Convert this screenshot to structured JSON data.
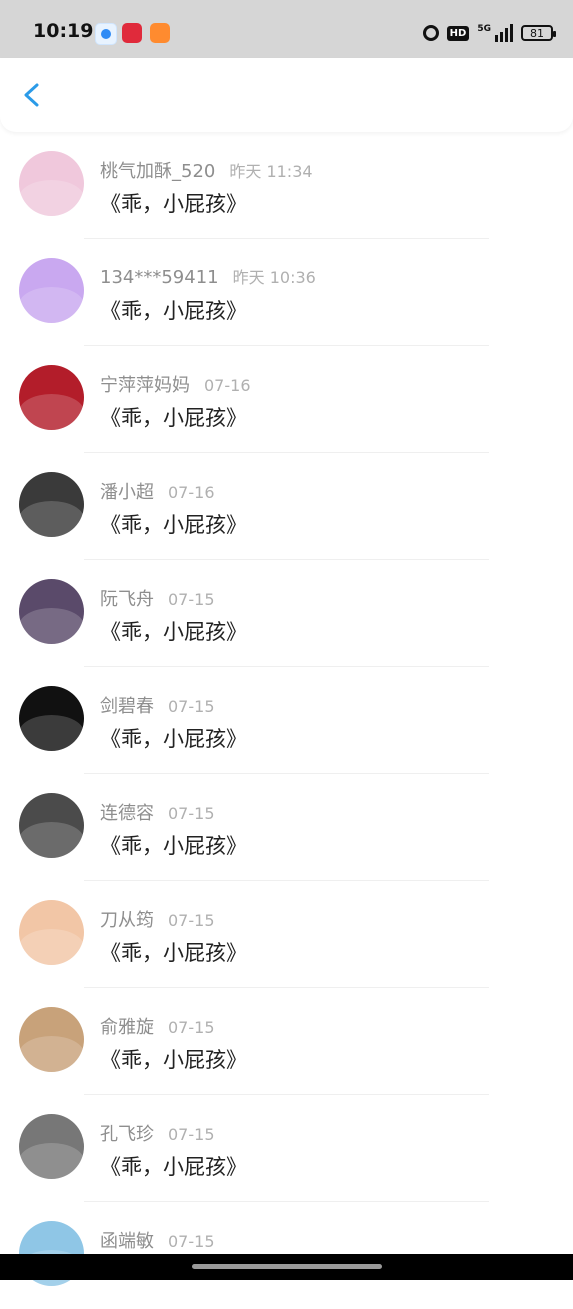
{
  "status_bar": {
    "time": "10:19",
    "network": "5G",
    "hd_label": "HD",
    "battery": "81"
  },
  "items": [
    {
      "name": "桃气加酥_520",
      "time": "昨天 11:34",
      "title": "《乖，小屁孩》",
      "avatar_color": "#f0c8dc"
    },
    {
      "name": "134***59411",
      "time": "昨天 10:36",
      "title": "《乖，小屁孩》",
      "avatar_color": "#c9a8f0"
    },
    {
      "name": "宁萍萍妈妈",
      "time": "07-16",
      "title": "《乖，小屁孩》",
      "avatar_color": "#b31d2a"
    },
    {
      "name": "潘小超",
      "time": "07-16",
      "title": "《乖，小屁孩》",
      "avatar_color": "#3a3a3a"
    },
    {
      "name": "阮飞舟",
      "time": "07-15",
      "title": "《乖，小屁孩》",
      "avatar_color": "#5a4a6a"
    },
    {
      "name": "剑碧春",
      "time": "07-15",
      "title": "《乖，小屁孩》",
      "avatar_color": "#111111"
    },
    {
      "name": "连德容",
      "time": "07-15",
      "title": "《乖，小屁孩》",
      "avatar_color": "#4b4b4b"
    },
    {
      "name": "刀从筠",
      "time": "07-15",
      "title": "《乖，小屁孩》",
      "avatar_color": "#f2c6a6"
    },
    {
      "name": "俞雅旋",
      "time": "07-15",
      "title": "《乖，小屁孩》",
      "avatar_color": "#c8a27a"
    },
    {
      "name": "孔飞珍",
      "time": "07-15",
      "title": "《乖，小屁孩》",
      "avatar_color": "#777777"
    },
    {
      "name": "函端敏",
      "time": "07-15",
      "title": "",
      "avatar_color": "#8fc6e6"
    }
  ]
}
